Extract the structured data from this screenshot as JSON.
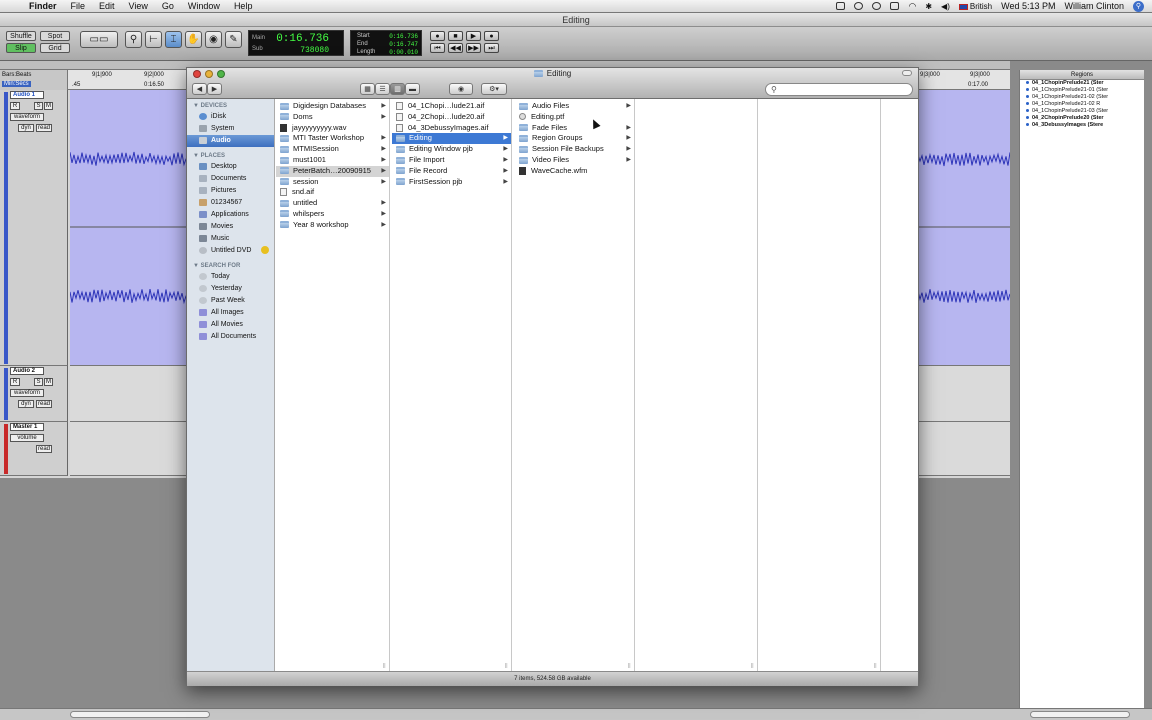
{
  "menubar": {
    "app_name": "Finder",
    "items": [
      "File",
      "Edit",
      "View",
      "Go",
      "Window",
      "Help"
    ],
    "input_menu": "British",
    "clock": "Wed 5:13 PM",
    "user": "William Clinton"
  },
  "protools": {
    "window_title": "Editing",
    "modes": {
      "shuffle": "Shuffle",
      "spot": "Spot",
      "slip": "Slip",
      "grid": "Grid"
    },
    "counter": {
      "main_label": "Main",
      "sub_label": "Sub",
      "main_value": "0:16.736",
      "sub_value": "738080"
    },
    "selection": {
      "start_label": "Start",
      "end_label": "End",
      "length_label": "Length",
      "start_value": "0:16.736",
      "end_value": "0:16.747",
      "length_value": "0:00.010"
    },
    "rulers": {
      "bars_beats_label": "Bars:Beats",
      "min_secs_label": "Min:Secs",
      "ticks_top": [
        "9|1|900",
        "9|2|000",
        "9|3|000",
        "9|3|000"
      ],
      "ticks_bottom": [
        "0:16.50",
        "0:17.00"
      ],
      "left_edge": ".45"
    },
    "tracks": [
      {
        "name": "Audio 1",
        "view": "waveform",
        "dyn": "dyn",
        "read": "read"
      },
      {
        "name": "Audio 2",
        "view": "waveform",
        "dyn": "dyn",
        "read": "read"
      },
      {
        "name": "Master 1",
        "view": "volume",
        "read": "read"
      }
    ],
    "solo_label": "S",
    "mute_label": "M",
    "rec_label": "R",
    "regions": {
      "header": "Regions",
      "items": [
        {
          "name": "04_1ChopinPrelude21 (Ster",
          "bold": true
        },
        {
          "name": "04_1ChopinPrelude21-01 (Ster",
          "bold": false
        },
        {
          "name": "04_1ChopinPrelude21-02 (Ster",
          "bold": false
        },
        {
          "name": "04_1ChopinPrelude21-02 R",
          "bold": false
        },
        {
          "name": "04_1ChopinPrelude21-03 (Ster",
          "bold": false
        },
        {
          "name": "04_2ChopinPrelude20 (Ster",
          "bold": true
        },
        {
          "name": "04_3DebussyImages (Stere",
          "bold": true
        }
      ]
    }
  },
  "finder": {
    "window_title": "Editing",
    "sidebar": {
      "devices_header": "DEVICES",
      "devices": [
        "iDisk",
        "System",
        "Audio"
      ],
      "places_header": "PLACES",
      "places": [
        "Desktop",
        "Documents",
        "Pictures",
        "01234567",
        "Applications",
        "Movies",
        "Music",
        "Untitled DVD"
      ],
      "search_header": "SEARCH FOR",
      "searches": [
        "Today",
        "Yesterday",
        "Past Week",
        "All Images",
        "All Movies",
        "All Documents"
      ]
    },
    "column1": [
      {
        "name": "Digidesign Databases",
        "type": "folder",
        "arrow": true
      },
      {
        "name": "Doms",
        "type": "folder",
        "arrow": true
      },
      {
        "name": "jayyyyyyyyy.wav",
        "type": "wav",
        "arrow": false
      },
      {
        "name": "MTI Taster Workshop",
        "type": "folder",
        "arrow": true
      },
      {
        "name": "MTMISession",
        "type": "folder",
        "arrow": true
      },
      {
        "name": "must1001",
        "type": "folder",
        "arrow": true
      },
      {
        "name": "PeterBatch…20090915",
        "type": "folder",
        "arrow": true,
        "state": "hl"
      },
      {
        "name": "session",
        "type": "folder",
        "arrow": true
      },
      {
        "name": "snd.aif",
        "type": "file",
        "arrow": false
      },
      {
        "name": "untitled",
        "type": "folder",
        "arrow": true
      },
      {
        "name": "whilspers",
        "type": "folder",
        "arrow": true
      },
      {
        "name": "Year 8 workshop",
        "type": "folder",
        "arrow": true
      }
    ],
    "column2": [
      {
        "name": "04_1Chopi…lude21.aif",
        "type": "file",
        "arrow": false
      },
      {
        "name": "04_2Chopi…lude20.aif",
        "type": "file",
        "arrow": false
      },
      {
        "name": "04_3DebussyImages.aif",
        "type": "file",
        "arrow": false
      },
      {
        "name": "Editing",
        "type": "folder",
        "arrow": true,
        "state": "sel"
      },
      {
        "name": "Editing Window pjb",
        "type": "folder",
        "arrow": true
      },
      {
        "name": "File Import",
        "type": "folder",
        "arrow": true
      },
      {
        "name": "File Record",
        "type": "folder",
        "arrow": true
      },
      {
        "name": "FirstSession pjb",
        "type": "folder",
        "arrow": true
      }
    ],
    "column3": [
      {
        "name": "Audio Files",
        "type": "folder",
        "arrow": true
      },
      {
        "name": "Editing.ptf",
        "type": "ptf",
        "arrow": false
      },
      {
        "name": "Fade Files",
        "type": "folder",
        "arrow": true
      },
      {
        "name": "Region Groups",
        "type": "folder",
        "arrow": true
      },
      {
        "name": "Session File Backups",
        "type": "folder",
        "arrow": true
      },
      {
        "name": "Video Files",
        "type": "folder",
        "arrow": true
      },
      {
        "name": "WaveCache.wfm",
        "type": "wav",
        "arrow": false
      }
    ],
    "status": "7 items, 524.58 GB available"
  },
  "colors": {
    "selection_blue": "#3d79d4",
    "audio_track_lane": "#b7b6f0",
    "waveform": "#2c33b8",
    "counter_green": "#44ff44"
  }
}
